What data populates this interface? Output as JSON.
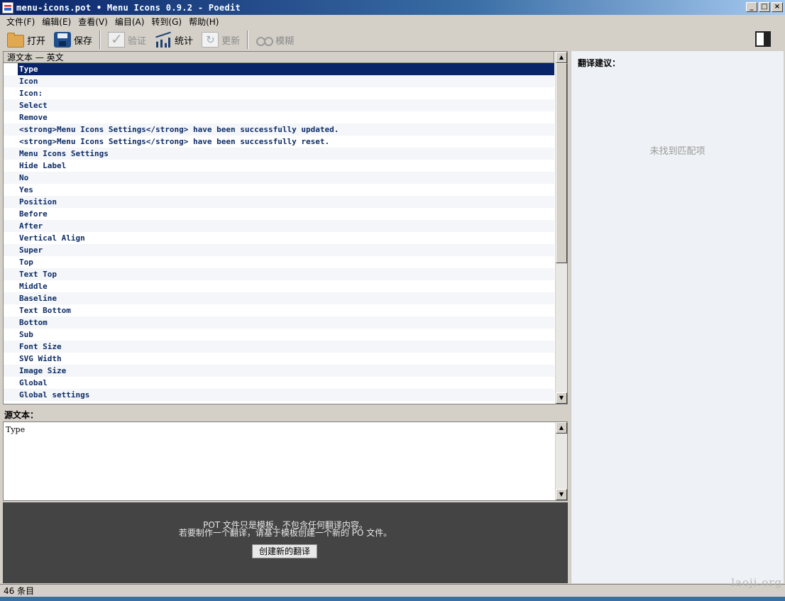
{
  "window": {
    "title": "menu-icons.pot • Menu Icons 0.9.2 - Poedit"
  },
  "menubar": [
    "文件(F)",
    "编辑(E)",
    "查看(V)",
    "编目(A)",
    "转到(G)",
    "帮助(H)"
  ],
  "toolbar": {
    "open": "打开",
    "save": "保存",
    "validate": "验证",
    "stats": "统计",
    "update": "更新",
    "fuzzy": "模糊"
  },
  "list": {
    "header": "源文本 — 英文",
    "rows": [
      "Type",
      "Icon",
      "Icon:",
      "Select",
      "Remove",
      "<strong>Menu Icons Settings</strong> have been successfully updated.",
      "<strong>Menu Icons Settings</strong> have been successfully reset.",
      "Menu Icons Settings",
      "Hide Label",
      "No",
      "Yes",
      "Position",
      "Before",
      "After",
      "Vertical Align",
      "Super",
      "Top",
      "Text Top",
      "Middle",
      "Baseline",
      "Text Bottom",
      "Bottom",
      "Sub",
      "Font Size",
      "SVG Width",
      "Image Size",
      "Global",
      "Global settings"
    ]
  },
  "source": {
    "label": "源文本：",
    "text": "Type"
  },
  "notice": {
    "line1": "POT 文件只是模板，不包含任何翻译内容。",
    "line2": "若要制作一个翻译，请基于模板创建一个新的 PO 文件。",
    "button": "创建新的翻译"
  },
  "suggestions": {
    "title": "翻译建议：",
    "empty": "未找到匹配项"
  },
  "status": {
    "count": "46 条目"
  },
  "watermark": "laoji.org"
}
